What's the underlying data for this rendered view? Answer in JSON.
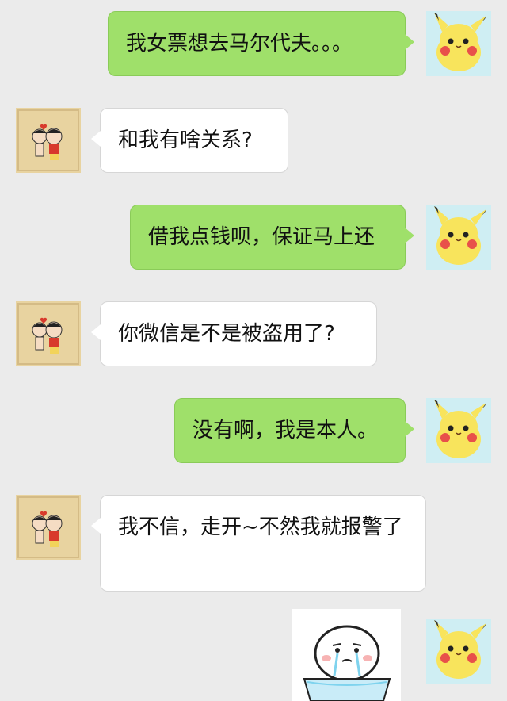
{
  "messages": [
    {
      "side": "out",
      "text": "我女票想去马尔代夫。。。"
    },
    {
      "side": "in",
      "text": "和我有啥关系?"
    },
    {
      "side": "out",
      "text": "借我点钱呗，保证马上还"
    },
    {
      "side": "in",
      "text": "你微信是不是被盗用了?"
    },
    {
      "side": "out",
      "text": "没有啊，我是本人。"
    },
    {
      "side": "in",
      "text": "我不信，走开~不然我就报警了"
    }
  ],
  "icons": {
    "self_avatar": "pikachu-avatar",
    "friend_avatar": "crayon-shin-chan-avatar",
    "sticker": "crying-face-sticker"
  },
  "colors": {
    "background": "#ebebeb",
    "outgoing_bubble": "#9fe06a",
    "incoming_bubble": "#ffffff"
  }
}
